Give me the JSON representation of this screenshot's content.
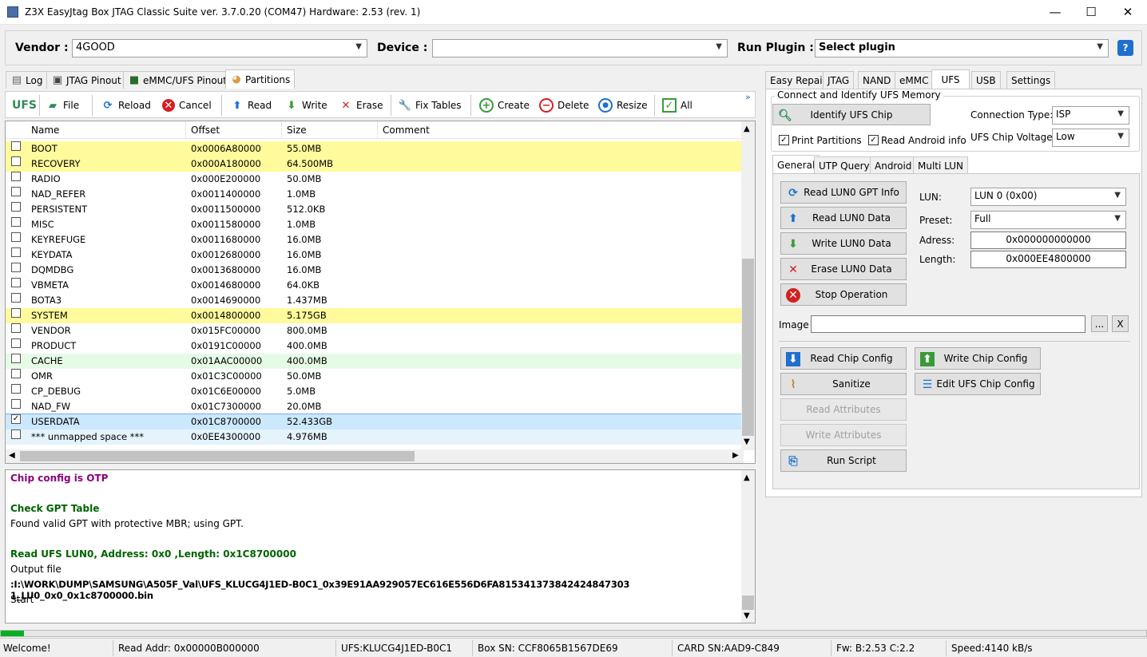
{
  "window": {
    "title": "Z3X EasyJtag Box JTAG Classic Suite ver. 3.7.0.20 (COM47) Hardware: 2.53 (rev. 1)",
    "minimize": "—",
    "maximize": "☐",
    "close": "✕"
  },
  "top": {
    "vendor_label": "Vendor :",
    "vendor_value": "4GOOD",
    "device_label": "Device :",
    "device_value": "",
    "plugin_label": "Run Plugin :",
    "plugin_value": "Select plugin",
    "help": "?"
  },
  "left_tabs": [
    {
      "label": "Log"
    },
    {
      "label": "JTAG Pinout"
    },
    {
      "label": "eMMC/UFS Pinout"
    },
    {
      "label": "Partitions"
    }
  ],
  "toolbar": {
    "ufs": "UFS",
    "file": "File",
    "reload": "Reload",
    "cancel": "Cancel",
    "read": "Read",
    "write": "Write",
    "erase": "Erase",
    "fix": "Fix Tables",
    "create": "Create",
    "delete": "Delete",
    "resize": "Resize",
    "all": "All",
    "more": "»"
  },
  "grid": {
    "headers": [
      "Name",
      "Offset",
      "Size",
      "Comment"
    ],
    "rows": [
      {
        "name": "BOOT",
        "offset": "0x0006A80000",
        "size": "55.0MB",
        "checked": "",
        "bg": "#fffa9c"
      },
      {
        "name": "RECOVERY",
        "offset": "0x000A180000",
        "size": "64.500MB",
        "checked": "",
        "bg": "#fffa9c"
      },
      {
        "name": "RADIO",
        "offset": "0x000E200000",
        "size": "50.0MB",
        "checked": "",
        "bg": "#ffffff"
      },
      {
        "name": "NAD_REFER",
        "offset": "0x0011400000",
        "size": "1.0MB",
        "checked": "",
        "bg": "#ffffff"
      },
      {
        "name": "PERSISTENT",
        "offset": "0x0011500000",
        "size": "512.0KB",
        "checked": "",
        "bg": "#ffffff"
      },
      {
        "name": "MISC",
        "offset": "0x0011580000",
        "size": "1.0MB",
        "checked": "",
        "bg": "#ffffff"
      },
      {
        "name": "KEYREFUGE",
        "offset": "0x0011680000",
        "size": "16.0MB",
        "checked": "",
        "bg": "#ffffff"
      },
      {
        "name": "KEYDATA",
        "offset": "0x0012680000",
        "size": "16.0MB",
        "checked": "",
        "bg": "#ffffff"
      },
      {
        "name": "DQMDBG",
        "offset": "0x0013680000",
        "size": "16.0MB",
        "checked": "",
        "bg": "#ffffff"
      },
      {
        "name": "VBMETA",
        "offset": "0x0014680000",
        "size": "64.0KB",
        "checked": "",
        "bg": "#ffffff"
      },
      {
        "name": "BOTA3",
        "offset": "0x0014690000",
        "size": "1.437MB",
        "checked": "",
        "bg": "#ffffff"
      },
      {
        "name": "SYSTEM",
        "offset": "0x0014800000",
        "size": "5.175GB",
        "checked": "",
        "bg": "#fffa9c"
      },
      {
        "name": "VENDOR",
        "offset": "0x015FC00000",
        "size": "800.0MB",
        "checked": "",
        "bg": "#ffffff"
      },
      {
        "name": "PRODUCT",
        "offset": "0x0191C00000",
        "size": "400.0MB",
        "checked": "",
        "bg": "#ffffff"
      },
      {
        "name": "CACHE",
        "offset": "0x01AAC00000",
        "size": "400.0MB",
        "checked": "",
        "bg": "#e6fbe6"
      },
      {
        "name": "OMR",
        "offset": "0x01C3C00000",
        "size": "50.0MB",
        "checked": "",
        "bg": "#ffffff"
      },
      {
        "name": "CP_DEBUG",
        "offset": "0x01C6E00000",
        "size": "5.0MB",
        "checked": "",
        "bg": "#ffffff"
      },
      {
        "name": "NAD_FW",
        "offset": "0x01C7300000",
        "size": "20.0MB",
        "checked": "",
        "bg": "#ffffff"
      },
      {
        "name": "USERDATA",
        "offset": "0x01C8700000",
        "size": "52.433GB",
        "checked": "✓",
        "bg": "#cce8ff"
      },
      {
        "name": "*** unmapped space ***",
        "offset": "0x0EE4300000",
        "size": "4.976MB",
        "checked": "",
        "bg": "#e5f3fb"
      }
    ]
  },
  "log": [
    {
      "text": "Chip config is OTP",
      "color": "#8b0080",
      "bold": true
    },
    {
      "text": "",
      "color": "#000",
      "bold": false
    },
    {
      "text": "Check GPT Table",
      "color": "#006400",
      "bold": true
    },
    {
      "text": "Found valid GPT with protective MBR; using GPT.",
      "color": "#000",
      "bold": false
    },
    {
      "text": "",
      "color": "#000",
      "bold": false
    },
    {
      "text": "Read UFS LUN0, Address: 0x0 ,Length: 0x1C8700000",
      "color": "#006400",
      "bold": true
    },
    {
      "text": "Output file",
      "color": "#000",
      "bold": false
    },
    {
      "text": ":I:\\WORK\\DUMP\\SAMSUNG\\A505F_Val\\UFS_KLUCG4J1ED-B0C1_0x39E91AA929057EC616E556D6FA815341373842424847303 1_LU0_0x0_0x1c8700000.bin",
      "color": "#000",
      "bold": true
    },
    {
      "text": "Start",
      "color": "#000",
      "bold": false
    }
  ],
  "right_tabs": [
    {
      "label": "Easy Repair"
    },
    {
      "label": "JTAG"
    },
    {
      "label": "NAND"
    },
    {
      "label": "eMMC"
    },
    {
      "label": "UFS"
    },
    {
      "label": "USB"
    },
    {
      "label": "Settings"
    }
  ],
  "ufs": {
    "group_title": "Connect and Identify UFS Memory",
    "identify": "Identify UFS Chip",
    "conn_label": "Connection Type:",
    "conn_value": "ISP",
    "print_part": "Print Partitions",
    "print_checked": "✓",
    "read_android": "Read Android info",
    "android_checked": "✓",
    "voltage_label": "UFS Chip Voltage :",
    "voltage_value": "Low"
  },
  "subtabs": [
    {
      "label": "General"
    },
    {
      "label": "UTP Query"
    },
    {
      "label": "Android"
    },
    {
      "label": "Multi LUN"
    }
  ],
  "general": {
    "read_gpt": "Read LUN0 GPT Info",
    "read_data": "Read LUN0 Data",
    "write_data": "Write LUN0 Data",
    "erase_data": "Erase LUN0 Data",
    "stop": "Stop Operation",
    "lun_label": "LUN:",
    "lun_value": "LUN 0 (0x00)",
    "preset_label": "Preset:",
    "preset_value": "Full",
    "addr_label": "Adress:",
    "addr_value": "0x000000000000",
    "len_label": "Length:",
    "len_value": "0x000EE4800000",
    "image_label": "Image",
    "image_value": "",
    "browse": "...",
    "clear": "X",
    "read_cfg": "Read Chip Config",
    "write_cfg": "Write Chip Config",
    "sanitize": "Sanitize",
    "edit_cfg": "Edit UFS Chip Config",
    "read_attr": "Read Attributes",
    "write_attr": "Write Attributes",
    "run_script": "Run Script"
  },
  "status": {
    "welcome": "Welcome!",
    "read_addr": "Read Addr: 0x00000B000000",
    "ufs": "UFS:KLUCG4J1ED-B0C1",
    "box": "Box SN: CCF8065B1567DE69",
    "card": "CARD SN:AAD9-C849",
    "fw": "Fw: B:2.53 C:2.2",
    "speed": "Speed:4140 kB/s"
  },
  "progress": {
    "fraction": 0.02
  }
}
